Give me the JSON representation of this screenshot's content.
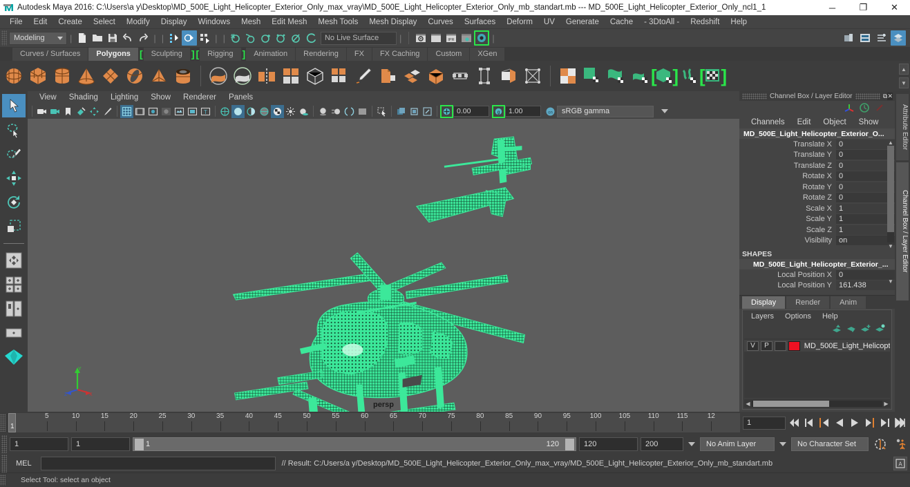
{
  "window": {
    "title": "Autodesk Maya 2016: C:\\Users\\a y\\Desktop\\MD_500E_Light_Helicopter_Exterior_Only_max_vray\\MD_500E_Light_Helicopter_Exterior_Only_mb_standart.mb  ---  MD_500E_Light_Helicopter_Exterior_Only_ncl1_1",
    "minimize": "─",
    "maximize": "❐",
    "close": "✕"
  },
  "menubar": {
    "items": [
      "File",
      "Edit",
      "Create",
      "Select",
      "Modify",
      "Display",
      "Windows",
      "Mesh",
      "Edit Mesh",
      "Mesh Tools",
      "Mesh Display",
      "Curves",
      "Surfaces",
      "Deform",
      "UV",
      "Generate",
      "Cache",
      "- 3DtoAll -",
      "Redshift",
      "Help"
    ]
  },
  "statusline": {
    "menu_set": "Modeling",
    "live_surface": "No Live Surface",
    "icons": [
      "new-scene-icon",
      "open-scene-icon",
      "save-scene-icon",
      "undo-icon",
      "redo-icon",
      "select-by-hierarchy-icon",
      "select-by-object-icon",
      "select-by-component-icon",
      "snap-to-grid-icon",
      "snap-to-curve-icon",
      "snap-to-point-icon",
      "snap-to-projected-center-icon",
      "snap-to-view-plane-icon",
      "make-live-icon",
      "render-current-frame-icon",
      "ipr-render-icon",
      "render-settings-icon",
      "render-view-icon",
      "render-globals-icon"
    ],
    "right_icons": [
      "sidebar-toggle-icon",
      "attribute-editor-icon",
      "tool-settings-icon",
      "channel-box-icon"
    ]
  },
  "shelf": {
    "tabs": [
      {
        "label": "Curves / Surfaces",
        "selected": false,
        "bracket": false
      },
      {
        "label": "Polygons",
        "selected": true,
        "bracket": false
      },
      {
        "label": "Sculpting",
        "selected": false,
        "bracket": true
      },
      {
        "label": "Rigging",
        "selected": false,
        "bracket": true
      },
      {
        "label": "Animation",
        "selected": false,
        "bracket": false
      },
      {
        "label": "Rendering",
        "selected": false,
        "bracket": false
      },
      {
        "label": "FX",
        "selected": false,
        "bracket": false
      },
      {
        "label": "FX Caching",
        "selected": false,
        "bracket": false
      },
      {
        "label": "Custom",
        "selected": false,
        "bracket": false
      },
      {
        "label": "XGen",
        "selected": false,
        "bracket": false
      }
    ],
    "icons": [
      "poly-sphere-icon",
      "poly-cube-icon",
      "poly-cylinder-icon",
      "poly-cone-icon",
      "poly-plane-icon",
      "poly-torus-icon",
      "poly-pyramid-icon",
      "poly-pipe-icon",
      "poly-booleans-union-icon",
      "poly-booleans-difference-icon",
      "poly-mirror-icon",
      "poly-combine-icon",
      "poly-smooth-icon",
      "poly-extract-icon",
      "poly-create-tool-icon",
      "poly-bevel-icon",
      "poly-multi-cut-icon",
      "poly-target-weld-icon",
      "poly-bridge-icon",
      "poly-fill-hole-icon",
      "poly-append-icon",
      "poly-quad-draw-icon",
      "uv-planar-icon",
      "uv-cylindrical-icon",
      "uv-spherical-icon",
      "uv-automatic-icon",
      "uv-unfold-icon",
      "uv-editor-icon",
      "uv-layout-icon"
    ],
    "colors": {
      "accent_green": "#2ae54a",
      "shelf_orange": "#e08a4a",
      "shelf_green": "#3ab87e"
    }
  },
  "toolbox": {
    "tools": [
      {
        "name": "select-tool",
        "selected": true
      },
      {
        "name": "lasso-select-tool",
        "selected": false
      },
      {
        "name": "paint-select-tool",
        "selected": false
      },
      {
        "name": "move-tool",
        "selected": false
      },
      {
        "name": "rotate-tool",
        "selected": false
      },
      {
        "name": "scale-tool",
        "selected": false
      }
    ],
    "layouts": [
      "single-pane-layout",
      "four-pane-layout",
      "two-pane-side-layout",
      "two-pane-stacked-layout",
      "persp-outliner-layout"
    ]
  },
  "viewport": {
    "panel_menu": [
      "View",
      "Shading",
      "Lighting",
      "Show",
      "Renderer",
      "Panels"
    ],
    "camera_label": "persp",
    "exposure": "0.00",
    "gamma_value": "1.00",
    "color_management": "sRGB gamma",
    "background_color": "#5d5d5d",
    "wireframe_color": "#45f0a0",
    "model_name": "MD_500E_Light_Helicopter_Exterior_Only",
    "axis": {
      "x": "X",
      "y": "Y",
      "z": "Z",
      "x_color": "#cc3333",
      "y_color": "#33cc33",
      "z_color": "#3355cc"
    }
  },
  "channel_box": {
    "panel_title": "Channel Box / Layer Editor",
    "menus": [
      "Channels",
      "Edit",
      "Object",
      "Show"
    ],
    "object_name": "MD_500E_Light_Helicopter_Exterior_O...",
    "channels": [
      {
        "label": "Translate X",
        "value": "0"
      },
      {
        "label": "Translate Y",
        "value": "0"
      },
      {
        "label": "Translate Z",
        "value": "0"
      },
      {
        "label": "Rotate X",
        "value": "0"
      },
      {
        "label": "Rotate Y",
        "value": "0"
      },
      {
        "label": "Rotate Z",
        "value": "0"
      },
      {
        "label": "Scale X",
        "value": "1"
      },
      {
        "label": "Scale Y",
        "value": "1"
      },
      {
        "label": "Scale Z",
        "value": "1"
      },
      {
        "label": "Visibility",
        "value": "on"
      }
    ],
    "shapes_header": "SHAPES",
    "shape_name": "MD_500E_Light_Helicopter_Exterior_...",
    "shape_channels": [
      {
        "label": "Local Position X",
        "value": "0"
      },
      {
        "label": "Local Position Y",
        "value": "161.438"
      }
    ]
  },
  "layer_editor": {
    "tabs": [
      {
        "label": "Display",
        "selected": true
      },
      {
        "label": "Render",
        "selected": false
      },
      {
        "label": "Anim",
        "selected": false
      }
    ],
    "menus": [
      "Layers",
      "Options",
      "Help"
    ],
    "buttons": [
      "move-layer-up-icon",
      "move-layer-down-icon",
      "new-layer-icon",
      "new-layer-from-selected-icon"
    ],
    "layers": [
      {
        "visibility": "V",
        "playback": "P",
        "shading": "",
        "color": "#ee1122",
        "name": "MD_500E_Light_Helicopt"
      }
    ]
  },
  "right_vtabs": [
    {
      "label": "Attribute Editor",
      "selected": false
    },
    {
      "label": "Channel Box / Layer Editor",
      "selected": true
    }
  ],
  "timeslider": {
    "tick_labels": [
      "5",
      "10",
      "15",
      "20",
      "25",
      "30",
      "35",
      "40",
      "45",
      "50",
      "55",
      "60",
      "65",
      "70",
      "75",
      "80",
      "85",
      "90",
      "95",
      "100",
      "105",
      "110",
      "115",
      "12"
    ],
    "current_frame": "1",
    "current_frame_field": "1",
    "playback_buttons": [
      "go-to-start-icon",
      "step-back-keyframe-icon",
      "step-back-frame-icon",
      "play-backwards-icon",
      "play-forwards-icon",
      "step-forward-frame-icon",
      "step-forward-keyframe-icon",
      "go-to-end-icon"
    ]
  },
  "rangebar": {
    "anim_start": "1",
    "range_start": "1",
    "slider_start": "1",
    "slider_end": "120",
    "range_end": "120",
    "anim_end": "200",
    "anim_layer": "No Anim Layer",
    "character_set": "No Character Set",
    "auto_key_icon": "auto-keyframe-icon",
    "pref_icon": "animation-preferences-icon"
  },
  "command_line": {
    "label": "MEL",
    "input_value": "",
    "result": "// Result: C:/Users/a y/Desktop/MD_500E_Light_Helicopter_Exterior_Only_max_vray/MD_500E_Light_Helicopter_Exterior_Only_mb_standart.mb",
    "script_editor_icon": "script-editor-icon"
  },
  "helpline": {
    "text": "Select Tool: select an object"
  }
}
